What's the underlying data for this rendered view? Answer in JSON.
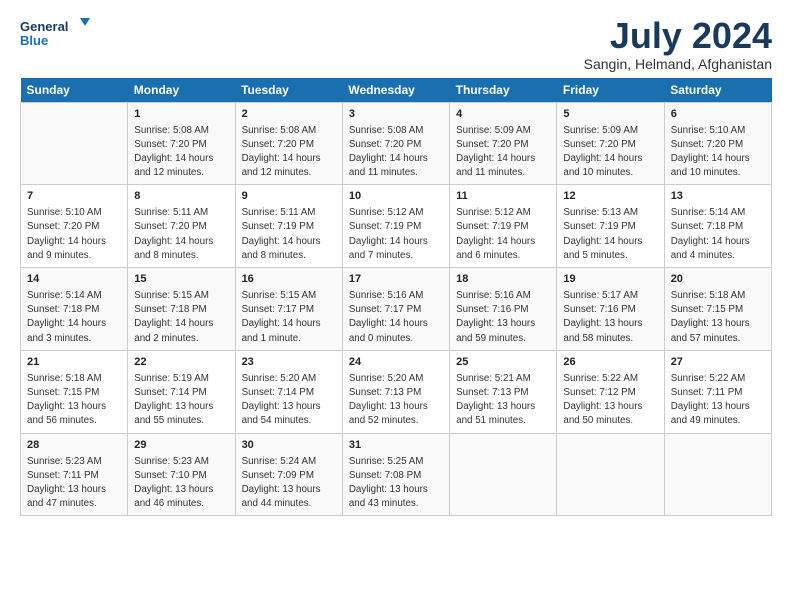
{
  "logo": {
    "line1": "General",
    "line2": "Blue"
  },
  "title": "July 2024",
  "subtitle": "Sangin, Helmand, Afghanistan",
  "days_header": [
    "Sunday",
    "Monday",
    "Tuesday",
    "Wednesday",
    "Thursday",
    "Friday",
    "Saturday"
  ],
  "weeks": [
    [
      {
        "day": "",
        "info": ""
      },
      {
        "day": "1",
        "info": "Sunrise: 5:08 AM\nSunset: 7:20 PM\nDaylight: 14 hours\nand 12 minutes."
      },
      {
        "day": "2",
        "info": "Sunrise: 5:08 AM\nSunset: 7:20 PM\nDaylight: 14 hours\nand 12 minutes."
      },
      {
        "day": "3",
        "info": "Sunrise: 5:08 AM\nSunset: 7:20 PM\nDaylight: 14 hours\nand 11 minutes."
      },
      {
        "day": "4",
        "info": "Sunrise: 5:09 AM\nSunset: 7:20 PM\nDaylight: 14 hours\nand 11 minutes."
      },
      {
        "day": "5",
        "info": "Sunrise: 5:09 AM\nSunset: 7:20 PM\nDaylight: 14 hours\nand 10 minutes."
      },
      {
        "day": "6",
        "info": "Sunrise: 5:10 AM\nSunset: 7:20 PM\nDaylight: 14 hours\nand 10 minutes."
      }
    ],
    [
      {
        "day": "7",
        "info": "Sunrise: 5:10 AM\nSunset: 7:20 PM\nDaylight: 14 hours\nand 9 minutes."
      },
      {
        "day": "8",
        "info": "Sunrise: 5:11 AM\nSunset: 7:20 PM\nDaylight: 14 hours\nand 8 minutes."
      },
      {
        "day": "9",
        "info": "Sunrise: 5:11 AM\nSunset: 7:19 PM\nDaylight: 14 hours\nand 8 minutes."
      },
      {
        "day": "10",
        "info": "Sunrise: 5:12 AM\nSunset: 7:19 PM\nDaylight: 14 hours\nand 7 minutes."
      },
      {
        "day": "11",
        "info": "Sunrise: 5:12 AM\nSunset: 7:19 PM\nDaylight: 14 hours\nand 6 minutes."
      },
      {
        "day": "12",
        "info": "Sunrise: 5:13 AM\nSunset: 7:19 PM\nDaylight: 14 hours\nand 5 minutes."
      },
      {
        "day": "13",
        "info": "Sunrise: 5:14 AM\nSunset: 7:18 PM\nDaylight: 14 hours\nand 4 minutes."
      }
    ],
    [
      {
        "day": "14",
        "info": "Sunrise: 5:14 AM\nSunset: 7:18 PM\nDaylight: 14 hours\nand 3 minutes."
      },
      {
        "day": "15",
        "info": "Sunrise: 5:15 AM\nSunset: 7:18 PM\nDaylight: 14 hours\nand 2 minutes."
      },
      {
        "day": "16",
        "info": "Sunrise: 5:15 AM\nSunset: 7:17 PM\nDaylight: 14 hours\nand 1 minute."
      },
      {
        "day": "17",
        "info": "Sunrise: 5:16 AM\nSunset: 7:17 PM\nDaylight: 14 hours\nand 0 minutes."
      },
      {
        "day": "18",
        "info": "Sunrise: 5:16 AM\nSunset: 7:16 PM\nDaylight: 13 hours\nand 59 minutes."
      },
      {
        "day": "19",
        "info": "Sunrise: 5:17 AM\nSunset: 7:16 PM\nDaylight: 13 hours\nand 58 minutes."
      },
      {
        "day": "20",
        "info": "Sunrise: 5:18 AM\nSunset: 7:15 PM\nDaylight: 13 hours\nand 57 minutes."
      }
    ],
    [
      {
        "day": "21",
        "info": "Sunrise: 5:18 AM\nSunset: 7:15 PM\nDaylight: 13 hours\nand 56 minutes."
      },
      {
        "day": "22",
        "info": "Sunrise: 5:19 AM\nSunset: 7:14 PM\nDaylight: 13 hours\nand 55 minutes."
      },
      {
        "day": "23",
        "info": "Sunrise: 5:20 AM\nSunset: 7:14 PM\nDaylight: 13 hours\nand 54 minutes."
      },
      {
        "day": "24",
        "info": "Sunrise: 5:20 AM\nSunset: 7:13 PM\nDaylight: 13 hours\nand 52 minutes."
      },
      {
        "day": "25",
        "info": "Sunrise: 5:21 AM\nSunset: 7:13 PM\nDaylight: 13 hours\nand 51 minutes."
      },
      {
        "day": "26",
        "info": "Sunrise: 5:22 AM\nSunset: 7:12 PM\nDaylight: 13 hours\nand 50 minutes."
      },
      {
        "day": "27",
        "info": "Sunrise: 5:22 AM\nSunset: 7:11 PM\nDaylight: 13 hours\nand 49 minutes."
      }
    ],
    [
      {
        "day": "28",
        "info": "Sunrise: 5:23 AM\nSunset: 7:11 PM\nDaylight: 13 hours\nand 47 minutes."
      },
      {
        "day": "29",
        "info": "Sunrise: 5:23 AM\nSunset: 7:10 PM\nDaylight: 13 hours\nand 46 minutes."
      },
      {
        "day": "30",
        "info": "Sunrise: 5:24 AM\nSunset: 7:09 PM\nDaylight: 13 hours\nand 44 minutes."
      },
      {
        "day": "31",
        "info": "Sunrise: 5:25 AM\nSunset: 7:08 PM\nDaylight: 13 hours\nand 43 minutes."
      },
      {
        "day": "",
        "info": ""
      },
      {
        "day": "",
        "info": ""
      },
      {
        "day": "",
        "info": ""
      }
    ]
  ]
}
